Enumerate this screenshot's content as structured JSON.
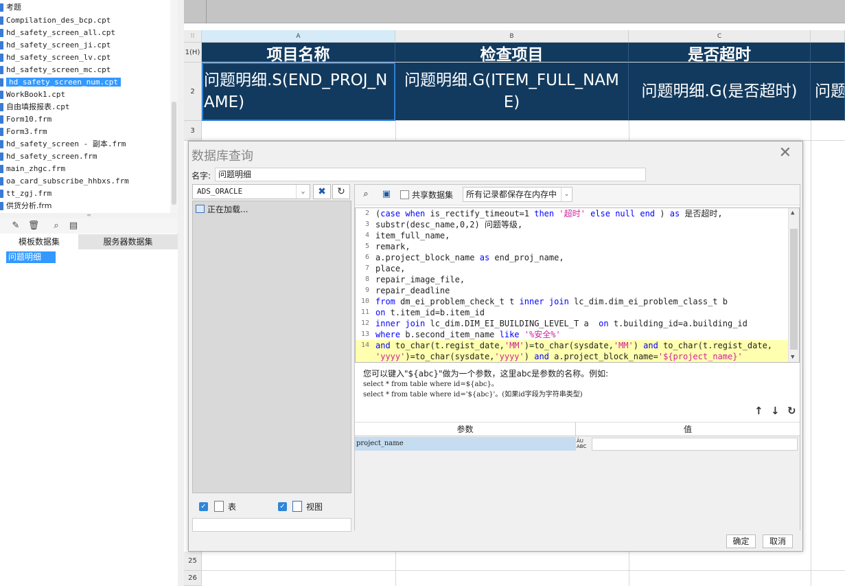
{
  "file_tree": {
    "items": [
      {
        "label": "考题",
        "selected": false
      },
      {
        "label": "Compilation_des_bcp.cpt",
        "selected": false
      },
      {
        "label": "hd_safety_screen_all.cpt",
        "selected": false
      },
      {
        "label": "hd_safety_screen_ji.cpt",
        "selected": false
      },
      {
        "label": "hd_safety_screen_lv.cpt",
        "selected": false
      },
      {
        "label": "hd_safety_screen_mc.cpt",
        "selected": false
      },
      {
        "label": "hd_safety_screen_num.cpt",
        "selected": true
      },
      {
        "label": "WorkBook1.cpt",
        "selected": false
      },
      {
        "label": "自由填报报表.cpt",
        "selected": false
      },
      {
        "label": "Form10.frm",
        "selected": false
      },
      {
        "label": "Form3.frm",
        "selected": false
      },
      {
        "label": "hd_safety_screen - 副本.frm",
        "selected": false
      },
      {
        "label": "hd_safety_screen.frm",
        "selected": false
      },
      {
        "label": "main_zhgc.frm",
        "selected": false
      },
      {
        "label": "oa_card_subscribe_hhbxs.frm",
        "selected": false
      },
      {
        "label": "tt_zgj.frm",
        "selected": false
      },
      {
        "label": "供货分析.frm",
        "selected": false
      }
    ]
  },
  "dataset_panel": {
    "tabs": [
      "模板数据集",
      "服务器数据集"
    ],
    "items": [
      "问题明细"
    ]
  },
  "sheet": {
    "columns": [
      "A",
      "B",
      "C"
    ],
    "row_labels": [
      "1(H)",
      "2",
      "3",
      "25",
      "26"
    ],
    "header_cells": [
      "项目名称",
      "检查项目",
      "是否超时"
    ],
    "data_cells": [
      "问题明细.S(END_PROJ_NAME)",
      "问题明细.G(ITEM_FULL_NAME)",
      "问题明细.G(是否超时)",
      "问题"
    ]
  },
  "dialog": {
    "title": "数据库查询",
    "name_label": "名字:",
    "name_value": "问题明细",
    "connection": "ADS_ORACLE",
    "loading_text": "正在加载...",
    "filter_table_label": "表",
    "filter_view_label": "视图",
    "share_dataset_label": "共享数据集",
    "memory_option": "所有记录都保存在内存中",
    "sql_lines": [
      {
        "n": "2",
        "code": "(case when is_rectify_timeout=1 then '超时' else null end ) as 是否超时,"
      },
      {
        "n": "3",
        "code": "substr(desc_name,0,2) 问题等级,"
      },
      {
        "n": "4",
        "code": "item_full_name,"
      },
      {
        "n": "5",
        "code": "remark,"
      },
      {
        "n": "6",
        "code": "a.project_block_name as end_proj_name,"
      },
      {
        "n": "7",
        "code": "place,"
      },
      {
        "n": "8",
        "code": "repair_image_file,"
      },
      {
        "n": "9",
        "code": "repair_deadline"
      },
      {
        "n": "10",
        "code": "from dm_ei_problem_check_t t inner join lc_dim.dim_ei_problem_class_t b"
      },
      {
        "n": "11",
        "code": "on t.item_id=b.item_id"
      },
      {
        "n": "12",
        "code": "inner join lc_dim.DIM_EI_BUILDING_LEVEL_T a  on t.building_id=a.building_id"
      },
      {
        "n": "13",
        "code": "where b.second_item_name like '%安全%'"
      },
      {
        "n": "14",
        "code": "and to_char(t.regist_date,'MM')=to_char(sysdate,'MM') and to_char(t.regist_date,"
      },
      {
        "n": "",
        "code": "'yyyy')=to_char(sysdate,'yyyy') and a.project_block_name='${project_name}'"
      }
    ],
    "hint": {
      "line1": "您可以键入\"${abc}\"做为一个参数，这里abc是参数的名称。例如:",
      "line2": "select * from table where id=${abc}。",
      "line3": "select * from table where id='${abc}'。(如果id字段为字符串类型)"
    },
    "param_table": {
      "col_param": "参数",
      "col_value": "值",
      "rows": [
        {
          "name": "project_name",
          "type": "ABC",
          "value": ""
        }
      ]
    },
    "ok_label": "确定",
    "cancel_label": "取消"
  },
  "colors": {
    "header_bg": "#123a5e",
    "selection": "#3399ff",
    "sql_keyword": "#0000ff",
    "sql_string": "#d11f9c",
    "highlight_line": "#ffffb0"
  }
}
